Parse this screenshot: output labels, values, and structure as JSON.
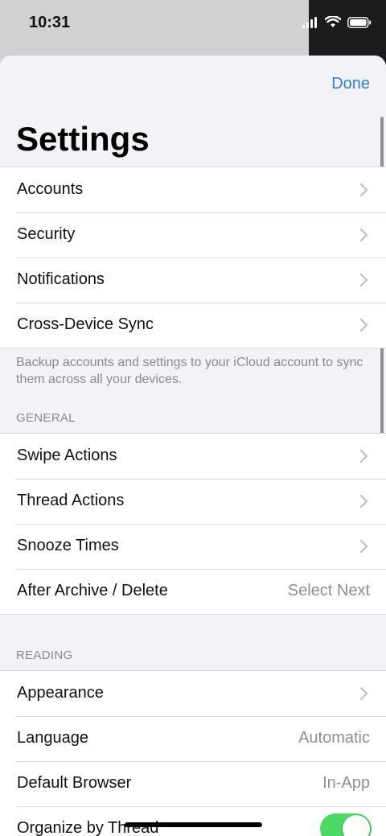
{
  "status": {
    "time": "10:31"
  },
  "nav": {
    "done_label": "Done",
    "title": "Settings"
  },
  "group_accounts": {
    "items": [
      {
        "label": "Accounts"
      },
      {
        "label": "Security"
      },
      {
        "label": "Notifications"
      },
      {
        "label": "Cross-Device Sync"
      }
    ],
    "footer": "Backup accounts and settings to your iCloud account to sync them across all your devices."
  },
  "general": {
    "header": "GENERAL",
    "items": [
      {
        "label": "Swipe Actions"
      },
      {
        "label": "Thread Actions"
      },
      {
        "label": "Snooze Times"
      },
      {
        "label": "After Archive / Delete",
        "value": "Select Next"
      }
    ]
  },
  "reading": {
    "header": "READING",
    "items": [
      {
        "label": "Appearance"
      },
      {
        "label": "Language",
        "value": "Automatic"
      },
      {
        "label": "Default Browser",
        "value": "In-App"
      },
      {
        "label": "Organize by Thread",
        "toggle_on": true
      }
    ]
  },
  "colors": {
    "accent": "#2f7ddb",
    "toggle_on": "#4cd964"
  },
  "icons": [
    "signal-icon",
    "wifi-icon",
    "battery-icon",
    "chevron-right-icon"
  ]
}
